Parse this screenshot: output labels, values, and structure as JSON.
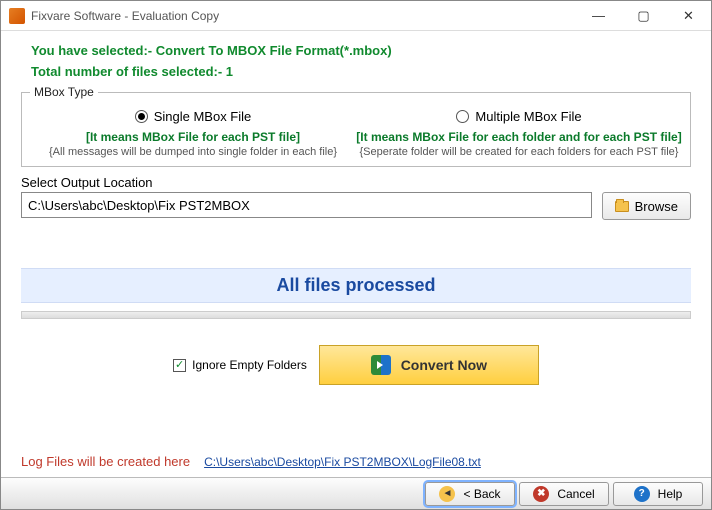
{
  "window": {
    "title": "Fixvare Software - Evaluation Copy"
  },
  "header": {
    "selection_line": "You have selected:- Convert To MBOX File Format(*.mbox)",
    "count_line": "Total number of files selected:- 1"
  },
  "mbox": {
    "legend": "MBox Type",
    "single": {
      "label": "Single MBox File",
      "desc_bold": "[It means MBox File for each PST file]",
      "desc_note": "{All messages will be dumped into single folder in each file}",
      "checked": true
    },
    "multiple": {
      "label": "Multiple MBox File",
      "desc_bold": "[It means MBox File for each folder and for each PST file]",
      "desc_note": "{Seperate folder will be created for each folders for each PST file}",
      "checked": false
    }
  },
  "output": {
    "label": "Select Output Location",
    "path": "C:\\Users\\abc\\Desktop\\Fix PST2MBOX",
    "browse": "Browse"
  },
  "status": {
    "banner": "All files processed"
  },
  "actions": {
    "ignore_label": "Ignore Empty Folders",
    "ignore_checked": true,
    "convert_label": "Convert Now"
  },
  "log": {
    "label": "Log Files will be created here",
    "link": "C:\\Users\\abc\\Desktop\\Fix PST2MBOX\\LogFile08.txt"
  },
  "footer": {
    "back": "< Back",
    "cancel": "Cancel",
    "help": "Help"
  }
}
